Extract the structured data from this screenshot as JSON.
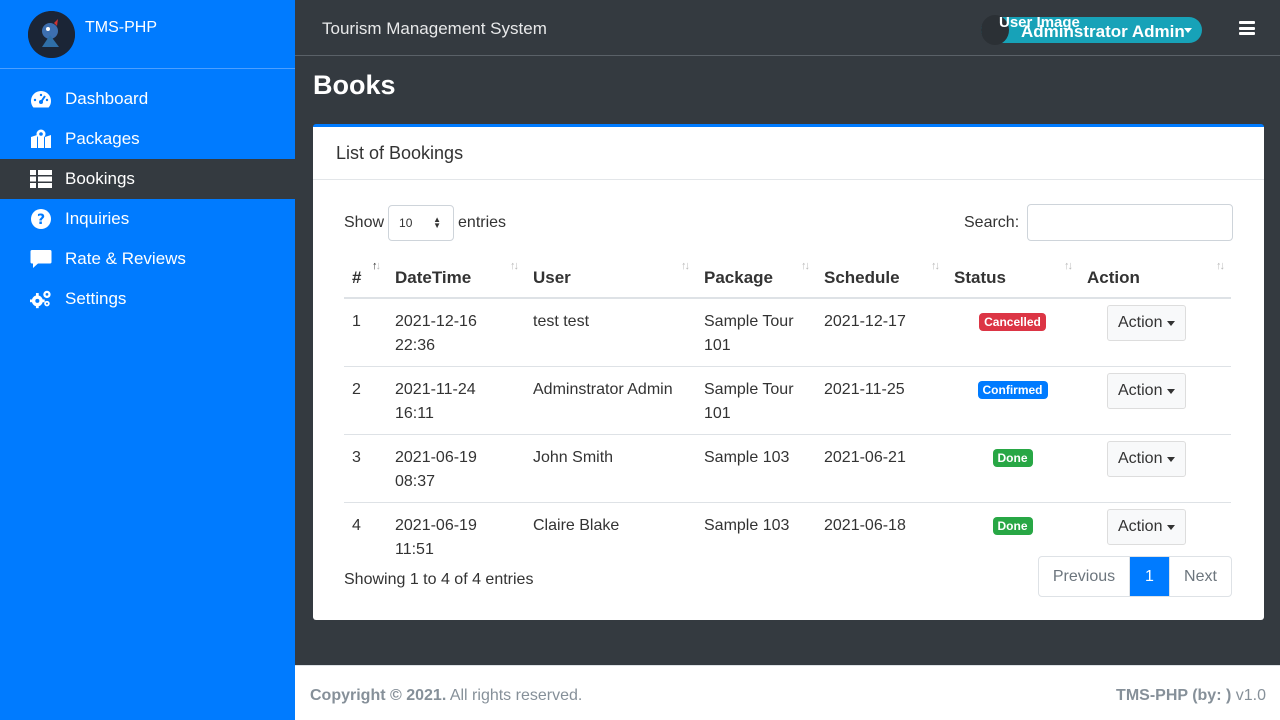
{
  "brand": {
    "name": "TMS-PHP"
  },
  "sidebar": {
    "items": [
      {
        "label": "Dashboard",
        "icon": "tachometer-icon"
      },
      {
        "label": "Packages",
        "icon": "map-marked-icon"
      },
      {
        "label": "Bookings",
        "icon": "table-list-icon",
        "active": true
      },
      {
        "label": "Inquiries",
        "icon": "question-circle-icon"
      },
      {
        "label": "Rate & Reviews",
        "icon": "comment-icon"
      },
      {
        "label": "Settings",
        "icon": "cogs-icon"
      }
    ]
  },
  "topbar": {
    "title": "Tourism Management System",
    "user_image_alt": "User Image",
    "user_name": "Adminstrator Admin"
  },
  "page": {
    "title": "Books"
  },
  "card": {
    "header": "List of Bookings",
    "show_label": "Show",
    "entries_value": "10",
    "entries_label": "entries",
    "search_label": "Search:",
    "search_value": ""
  },
  "table": {
    "columns": [
      "#",
      "DateTime",
      "User",
      "Package",
      "Schedule",
      "Status",
      "Action"
    ],
    "rows": [
      {
        "num": "1",
        "date": "2021-12-16",
        "time": "22:36",
        "user": "test test",
        "package": "Sample Tour 101",
        "schedule": "2021-12-17",
        "status": "Cancelled",
        "status_color": "#dc3545",
        "action": "Action"
      },
      {
        "num": "2",
        "date": "2021-11-24",
        "time": "16:11",
        "user": "Adminstrator Admin",
        "package": "Sample Tour 101",
        "schedule": "2021-11-25",
        "status": "Confirmed",
        "status_color": "#007bff",
        "action": "Action"
      },
      {
        "num": "3",
        "date": "2021-06-19",
        "time": "08:37",
        "user": "John Smith",
        "package": "Sample 103",
        "schedule": "2021-06-21",
        "status": "Done",
        "status_color": "#28a745",
        "action": "Action"
      },
      {
        "num": "4",
        "date": "2021-06-19",
        "time": "11:51",
        "user": "Claire Blake",
        "package": "Sample 103",
        "schedule": "2021-06-18",
        "status": "Done",
        "status_color": "#28a745",
        "action": "Action"
      }
    ]
  },
  "pagination": {
    "info": "Showing 1 to 4 of 4 entries",
    "previous": "Previous",
    "current": "1",
    "next": "Next"
  },
  "footer": {
    "copyright": "Copyright © 2021.",
    "rights": " All rights reserved.",
    "brand": "TMS-PHP (by: )",
    "version": " v1.0"
  }
}
